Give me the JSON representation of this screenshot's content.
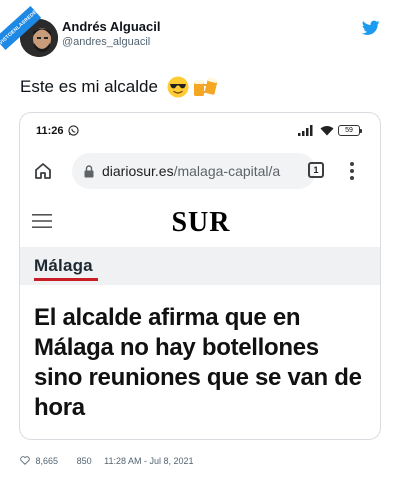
{
  "watermark": "VISTOENLASREDES.com",
  "author": {
    "name": "Andrés Alguacil",
    "handle": "@andres_alguacil"
  },
  "tweet": {
    "text": "Este es mi alcalde",
    "emojis": [
      "sunglasses-face",
      "beer-mugs"
    ]
  },
  "screenshot": {
    "status_bar": {
      "time": "11:26",
      "battery": "59"
    },
    "browser": {
      "url_domain": "diariosur.es",
      "url_path": "/malaga-capital/a",
      "tab_count": "1"
    },
    "site": {
      "logo": "SUR",
      "section": "Málaga",
      "headline": "El alcalde afirma que en Málaga no hay botellones sino reuniones que se van de hora"
    }
  },
  "footer": {
    "likes": "8,665",
    "replies": "850",
    "timestamp": "11:28 AM - Jul 8, 2021"
  },
  "colors": {
    "twitter_blue": "#1d9bf0",
    "section_underline": "#c81d25",
    "band_background": "#f0f1f2"
  }
}
